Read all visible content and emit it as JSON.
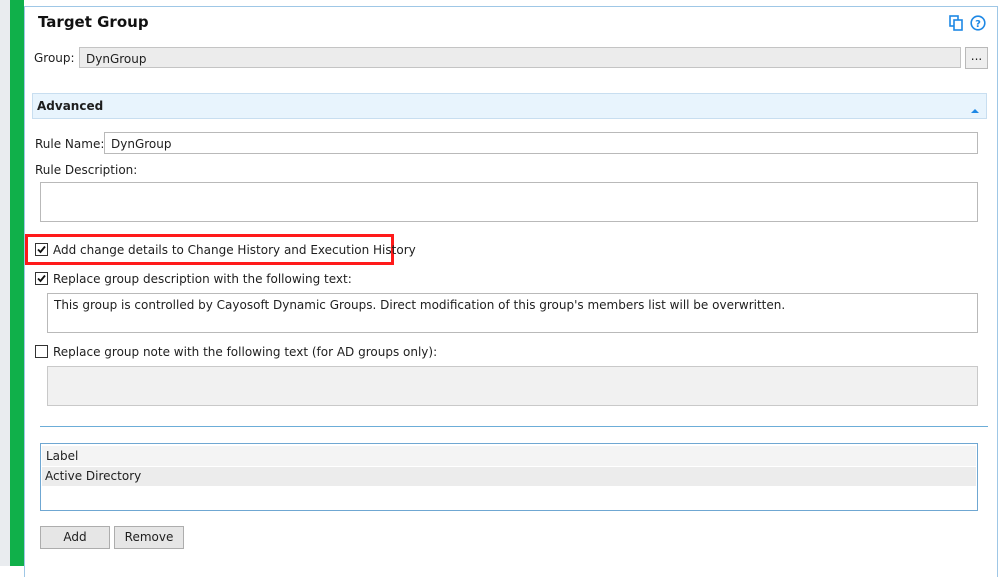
{
  "title": "Target Group",
  "group": {
    "label": "Group:",
    "value": "DynGroup",
    "browse_label": "..."
  },
  "advanced": {
    "header": "Advanced",
    "rule_name_label": "Rule Name:",
    "rule_name_value": "DynGroup",
    "rule_description_label": "Rule Description:",
    "rule_description_value": ""
  },
  "options": {
    "change_history": {
      "label": "Add change details to Change History and Execution History",
      "checked": true
    },
    "replace_description": {
      "label": "Replace group description with the following text:",
      "checked": true,
      "text": "This group is controlled by Cayosoft Dynamic Groups. Direct modification of this group's members list will be overwritten."
    },
    "replace_note": {
      "label": "Replace group note with the following text (for AD groups only):",
      "checked": false,
      "text": ""
    }
  },
  "labels_list": {
    "column_header": "Label",
    "rows": [
      "Active Directory"
    ]
  },
  "buttons": {
    "add": "Add",
    "remove": "Remove"
  },
  "colors": {
    "accent_green": "#10b04a",
    "highlight_red": "#ff1a1a",
    "section_bg": "#e8f4fd",
    "link_blue": "#1e88e5"
  }
}
